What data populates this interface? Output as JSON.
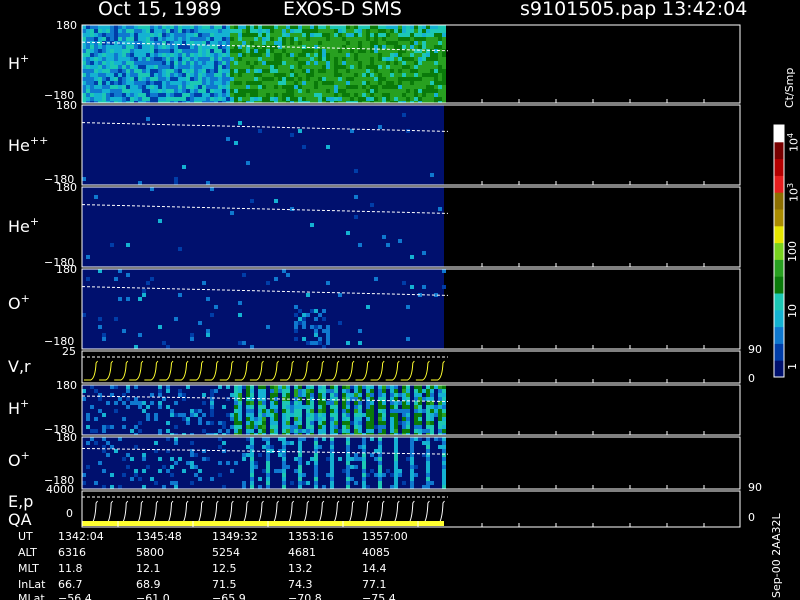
{
  "header": {
    "date": "Oct 15, 1989",
    "instrument": "EXOS-D SMS",
    "filename": "s9101505.pap",
    "time": "13:42:04"
  },
  "colors": {
    "background": "#000000",
    "frame": "#ffffff",
    "trace_yellow": "#ffff30",
    "colormap": [
      "#00106e",
      "#003da8",
      "#0f78cf",
      "#14b2d2",
      "#1cc8b4",
      "#0a7a0a",
      "#28a020",
      "#78d21e",
      "#e6e600",
      "#aa8c00",
      "#8c6e00",
      "#e61e1e",
      "#b40000",
      "#780000",
      "#ffffff"
    ]
  },
  "colorbar": {
    "title": "Ct/Smp",
    "tick_labels": [
      "1",
      "10",
      "100",
      "10",
      "10"
    ],
    "tick_exponents": [
      "",
      "",
      "",
      "3",
      "4"
    ],
    "side_label": "Sep-00  2AA32L"
  },
  "panels": [
    {
      "id": "hplus",
      "label": "H",
      "sup": "+",
      "ymax": "180",
      "ymin": "−180",
      "kind": "spectrogram",
      "mode": "hplus"
    },
    {
      "id": "hepp",
      "label": "He",
      "sup": "++",
      "ymax": "180",
      "ymin": "−180",
      "kind": "spectrogram",
      "mode": "quiet"
    },
    {
      "id": "heplus",
      "label": "He",
      "sup": "+",
      "ymax": "180",
      "ymin": "−180",
      "kind": "spectrogram",
      "mode": "quiet"
    },
    {
      "id": "oplus",
      "label": "O",
      "sup": "+",
      "ymax": "180",
      "ymin": "−180",
      "kind": "spectrogram",
      "mode": "oplus"
    },
    {
      "id": "vr",
      "label": "V,r",
      "sup": "",
      "ymax": "25",
      "ymin": "",
      "right_top": "90",
      "right_bottom": "0",
      "kind": "trace"
    },
    {
      "id": "hplus2",
      "label": "H",
      "sup": "+",
      "ymax": "180",
      "ymin": "−180",
      "kind": "spectrogram",
      "mode": "striped"
    },
    {
      "id": "oplus2",
      "label": "O",
      "sup": "+",
      "ymax": "180",
      "ymin": "−180",
      "kind": "spectrogram",
      "mode": "striped_o"
    },
    {
      "id": "ep",
      "label": "E,p",
      "label2": "QA",
      "sup": "",
      "ymax": "4000",
      "ymin": "0",
      "right_top": "90",
      "right_bottom": "0",
      "kind": "trace"
    }
  ],
  "chart_data": {
    "type": "heatmap",
    "x_axis_unit": "UT",
    "x_ticks": [
      "1342:04",
      "1345:48",
      "1349:32",
      "1353:16",
      "1357:00"
    ],
    "y_range_pitch": [
      -180,
      180
    ],
    "colorbar_range_log": [
      1,
      10000
    ],
    "ephemeris": [
      {
        "name": "UT",
        "values": [
          "1342:04",
          "1345:48",
          "1349:32",
          "1353:16",
          "1357:00"
        ]
      },
      {
        "name": "ALT",
        "values": [
          "6316",
          "5800",
          "5254",
          "4681",
          "4085"
        ]
      },
      {
        "name": "MLT",
        "values": [
          "11.8",
          "12.1",
          "12.5",
          "13.2",
          "14.4"
        ]
      },
      {
        "name": "InLat",
        "values": [
          "66.7",
          "68.9",
          "71.5",
          "74.3",
          "77.1"
        ]
      },
      {
        "name": "MLat",
        "values": [
          "−56.4",
          "−61.0",
          "−65.9",
          "−70.8",
          "−75.4"
        ]
      }
    ]
  }
}
